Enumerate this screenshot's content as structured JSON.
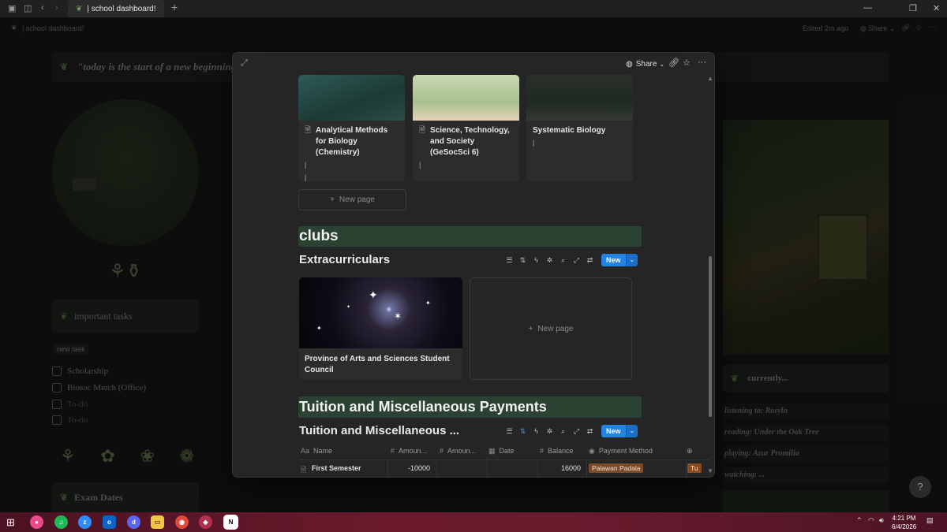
{
  "window": {
    "tab_title": "| school dashboard!",
    "new_tab": "+",
    "min": "—",
    "restore": "❐",
    "close": "✕"
  },
  "topbar": {
    "breadcrumb": "| school dashboard!",
    "edited": "Edited 2m ago",
    "share": "Share",
    "more": "···"
  },
  "background_page": {
    "quote": "\"today is the start of a new beginning",
    "important_tasks": "important  tasks",
    "new_task": "new task",
    "todos": [
      {
        "label": "Scholarship",
        "dim": false
      },
      {
        "label": "Biosoc Merch (Office)",
        "dim": false
      },
      {
        "label": "To-do",
        "dim": true
      },
      {
        "label": "To-do",
        "dim": true
      }
    ],
    "exam_dates": "Exam Dates",
    "currently": "currently...",
    "status": [
      {
        "label": "listening to: Rosyln"
      },
      {
        "label": "reading: Under the Oak Tree"
      },
      {
        "label": "playing: Azur Promilia"
      },
      {
        "label": "watching: ..."
      }
    ]
  },
  "modal": {
    "share": "Share",
    "gallery_cards": [
      {
        "title": "Analytical Methods for Biology (Chemistry)",
        "bars": 2,
        "color": "#2c4c45"
      },
      {
        "title": "Science, Technology, and Society (GeSocSci 6)",
        "bars": 1,
        "color": "#a8c08e"
      },
      {
        "title": "Systematic Biology",
        "bars": 1,
        "color": "#1f2a22"
      }
    ],
    "new_page": "New page",
    "clubs_heading": "clubs",
    "extracurriculars_title": "Extracurriculars",
    "new_button": "New",
    "club_card_title": "Province of Arts and Sciences Student Council",
    "tuition_heading": "Tuition and Miscellaneous Payments",
    "tuition_db_title": "Tuition and Miscellaneous ...",
    "table_headers": [
      "Name",
      "Amoun...",
      "Amoun...",
      "Date",
      "Balance",
      "Payment Method"
    ],
    "rows": [
      {
        "name": "First Semester",
        "amount1": "-10000",
        "amount2": "",
        "date": "",
        "balance": "16000",
        "method": "Palawan Padala",
        "extra": "Tu"
      }
    ]
  },
  "taskbar": {
    "time": "4:21 PM",
    "date": "6/4/2026"
  },
  "colors": {
    "accent_green": "#2b4233",
    "button_blue": "#2383e2",
    "payment_pill": "#7a4a2a",
    "taskbar": "#6a1a2c"
  }
}
